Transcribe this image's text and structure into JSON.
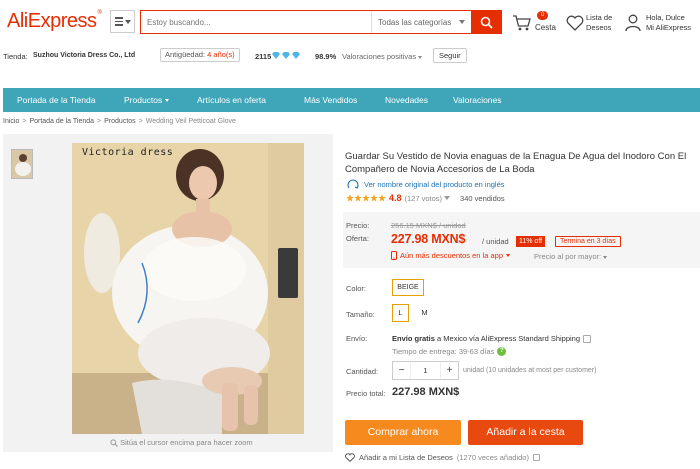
{
  "header": {
    "logo": "AliExpress",
    "logo_mark": "®",
    "search_placeholder": "Estoy buscando...",
    "search_category": "Todas las categorías",
    "cart_count": "0",
    "cart_label": "Cesta",
    "wishlist_label_1": "Lista de",
    "wishlist_label_2": "Deseos",
    "account_line_1": "Hola, Dulce",
    "account_line_2": "Mi AliExpress"
  },
  "store": {
    "label": "Tienda:",
    "name": "Suzhou Victoria Dress Co., Ltd",
    "age_label": "Antigüedad:",
    "age_value": "4 año(s)",
    "score": "2115",
    "positive_value": "98.9%",
    "positive_label": "Valoraciones positivas",
    "follow": "Seguir"
  },
  "nav": {
    "items": [
      "Portada de la Tienda",
      "Productos",
      "Artículos en oferta",
      "Más Vendidos",
      "Novedades",
      "Valoraciones"
    ]
  },
  "breadcrumb": [
    "Inicio",
    "Portada de la Tienda",
    "Productos",
    "Wedding Veil Petticoat Glove"
  ],
  "gallery": {
    "watermark": "Victoria dress",
    "zoom_hint": "Sitúa el cursor encima para hacer zoom"
  },
  "product": {
    "title": "Guardar Su Vestido de Novia enaguas de la Enagua De Agua del Inodoro Con El Compañero de Novia Accesorios de La Boda",
    "original_link": "Ver nombre original del producto en inglés",
    "rating_value": "4.8",
    "rating_votes": "(127 votos)",
    "rating_stars": 4.8,
    "sold": "340 vendidos",
    "price_label": "Precio:",
    "old_price": "256.15 MXN$ / unidad",
    "offer_label": "Oferta:",
    "new_price": "227.98 MXN$",
    "unit": "/ unidad",
    "discount": "11% off",
    "ends": "Termina en 3 días",
    "more_discounts": "Aún más descuentos en la app",
    "wholesale": "Precio al por mayor:",
    "color_label": "Color:",
    "color_option": "BEIGE",
    "size_label": "Tamaño:",
    "sizes": [
      "L",
      "M"
    ],
    "ship_label": "Envío:",
    "ship_bold": "Envío gratis",
    "ship_rest": " a Mexico vía AliExpress Standard Shipping",
    "delivery": "Tiempo de entrega: 39-63 días",
    "qty_label": "Cantidad:",
    "qty_minus": "−",
    "qty_value": "1",
    "qty_plus": "+",
    "qty_note": "unidad (10 unidades at most per customer)",
    "total_label": "Precio total:",
    "total_value": "227.98 MXN$",
    "buy_now": "Comprar ahora",
    "add_to_cart": "Añadir a la cesta",
    "wish_add": "Añadir a mi Lista de Deseos",
    "wish_count": "(1270 veces añadido)"
  },
  "colors": {
    "brand": "#e62e04",
    "nav": "#3ea6b8",
    "buy": "#f68a1f",
    "cart": "#e8490f"
  }
}
